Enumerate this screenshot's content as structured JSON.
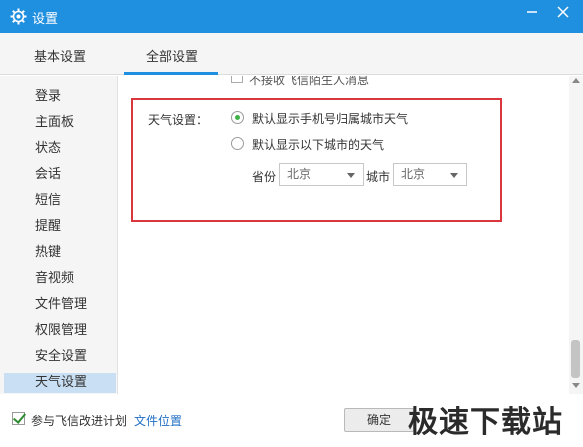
{
  "window": {
    "title": "设置",
    "icon": "gear-icon",
    "accent_color": "#1f8fe0"
  },
  "tabs": [
    {
      "label": "基本设置",
      "selected": false
    },
    {
      "label": "全部设置",
      "selected": true
    }
  ],
  "sidebar": {
    "items": [
      {
        "label": "登录"
      },
      {
        "label": "主面板"
      },
      {
        "label": "状态"
      },
      {
        "label": "会话"
      },
      {
        "label": "短信"
      },
      {
        "label": "提醒"
      },
      {
        "label": "热键"
      },
      {
        "label": "音视频"
      },
      {
        "label": "文件管理"
      },
      {
        "label": "权限管理"
      },
      {
        "label": "安全设置"
      },
      {
        "label": "天气设置",
        "selected": true
      }
    ]
  },
  "content": {
    "cut_off_text": "不接收飞信陌生人消息",
    "weather": {
      "label": "天气设置：",
      "option1": "默认显示手机号归属城市天气",
      "option2": "默认显示以下城市的天气",
      "selected_option": 1,
      "province_label": "省份",
      "province_value": "北京",
      "city_label": "城市",
      "city_value": "北京"
    },
    "highlight_color": "#d9363e"
  },
  "footer": {
    "checkbox_label": "参与飞信改进计划",
    "checkbox_checked": true,
    "link_label": "文件位置",
    "ok_label": "确定",
    "watermark": "极速下载站"
  }
}
